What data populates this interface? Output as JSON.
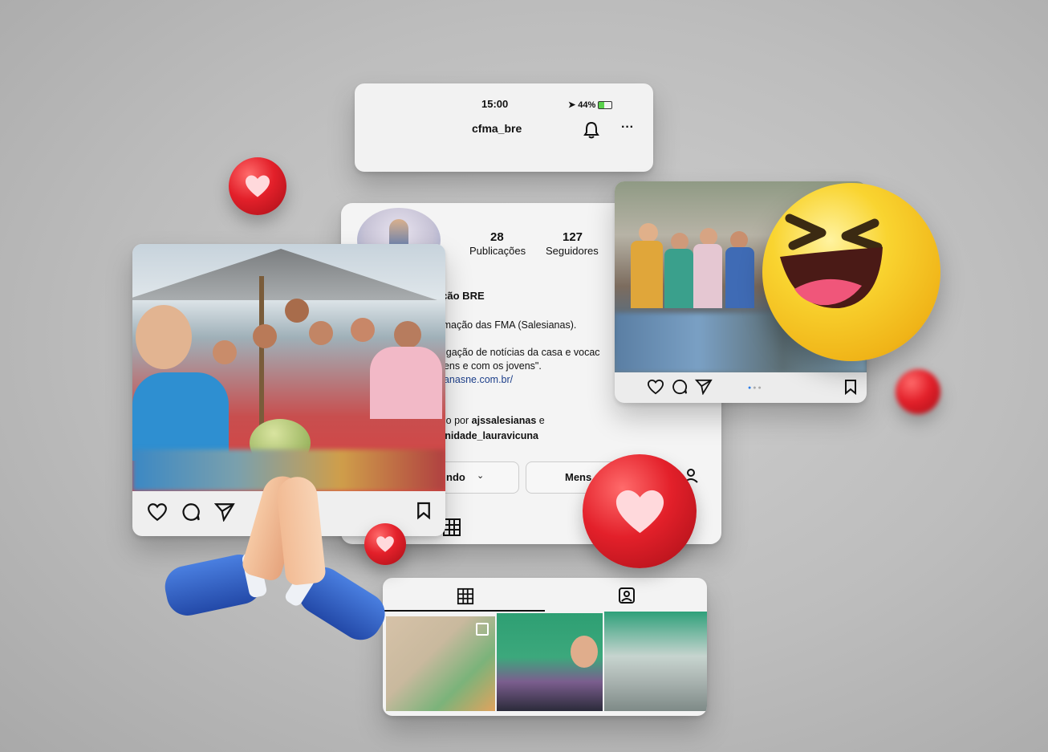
{
  "status_bar": {
    "time": "15:00",
    "battery": "44%"
  },
  "profile": {
    "username": "cfma_bre",
    "posts_count": "28",
    "posts_label": "Publicações",
    "followers_count": "127",
    "followers_label": "Seguidores",
    "name": "nação BRE",
    "bio_lines": [
      "formação das FMA (Salesianas).",
      "E.",
      "ivulgação de notícias da casa e vocac",
      "jovens e com os jovens\".",
      "esianasne.com.br/"
    ],
    "followed_line1_prefix": "uido por ",
    "followed_line1_user": "ajssalesianas",
    "followed_line1_suffix": " e",
    "followed_line2_user": "nunidade_lauravicuna",
    "following_button": "ndo",
    "message_button": "Mens"
  },
  "icons": {
    "bell": "bell-icon",
    "more": "more-icon",
    "heart": "heart-icon",
    "comment": "comment-icon",
    "share": "send-icon",
    "bookmark": "bookmark-icon",
    "grid": "grid-icon",
    "tagged": "tagged-icon",
    "add_person": "add-person-icon"
  },
  "colors": {
    "like_red": "#e3202a",
    "emoji_yellow": "#f7c51e",
    "sleeve_blue": "#2f5fc4"
  }
}
